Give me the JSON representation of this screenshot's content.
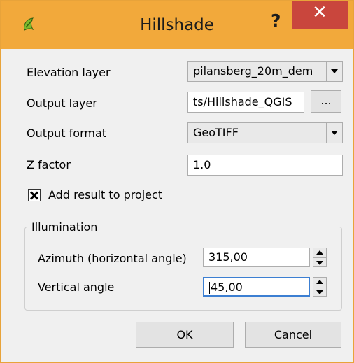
{
  "window": {
    "title": "Hillshade",
    "help_glyph": "?",
    "close_glyph": "✕",
    "icon": "qgis-icon"
  },
  "form": {
    "elevation_label": "Elevation layer",
    "elevation_value": "pilansberg_20m_dem",
    "output_layer_label": "Output layer",
    "output_layer_value": "ts/Hillshade_QGIS",
    "browse_label": "...",
    "output_format_label": "Output format",
    "output_format_value": "GeoTIFF",
    "z_factor_label": "Z factor",
    "z_factor_value": "1.0",
    "add_result_label": "Add result to project",
    "add_result_checked": true
  },
  "illumination": {
    "title": "Illumination",
    "azimuth_label": "Azimuth (horizontal angle)",
    "azimuth_value": "315,00",
    "vertical_label": "Vertical angle",
    "vertical_value": "45,00"
  },
  "buttons": {
    "ok": "OK",
    "cancel": "Cancel"
  }
}
